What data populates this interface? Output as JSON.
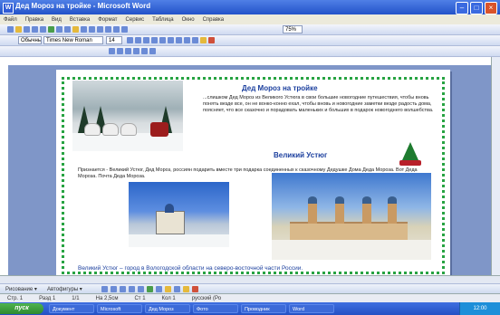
{
  "window": {
    "title": "Дед Мороз на тройке - Microsoft Word",
    "icon": "word-icon",
    "buttons": [
      "minimize-icon",
      "maximize-icon",
      "close-icon"
    ]
  },
  "menubar": {
    "items": [
      "Файл",
      "Правка",
      "Вид",
      "Вставка",
      "Формат",
      "Сервис",
      "Таблица",
      "Окно",
      "Справка"
    ]
  },
  "toolbar": {
    "style": "Обычный",
    "font": "Times New Roman",
    "size": "14",
    "zoom": "75%"
  },
  "document": {
    "heading1": "Дед Мороз на тройке",
    "para1": "...слишком Дед Мороз из Великого Устюга в свои большие новогодние путешествия, чтобы вновь понять везде все, он не вонко-конно ехал, чтобы вновь и новогодние заметки везде радость дома, поясняет, что все сказочно и порадовать маленьких и больших в подарок новогоднего волшебства.",
    "heading2": "Великий Устюг",
    "para2": "Признается - Великий Устюг, Дед Мороз, россиян подарить вместе три подарка соединенных к сказочному Дедушке Дома Деда Мороза. Вот Деда Мороза. Почта Деда Мороза.",
    "caption": "Великий Устюг – город в Вологодской области на северо-восточной части России."
  },
  "drawbar": {
    "draw_label": "Рисование ▾",
    "autoshapes_label": "Автофигуры ▾"
  },
  "statusbar": {
    "page": "Стр. 1",
    "section": "Разд 1",
    "pages": "1/1",
    "position": "На 2,5см",
    "line": "Ст 1",
    "col": "Кол 1",
    "lang": "русский (Ро"
  },
  "taskbar": {
    "start_label": "пуск",
    "tasks": [
      "Документ",
      "Microsoft",
      "Дед Мороз",
      "Фото",
      "Проводник",
      "Word"
    ],
    "clock": "12:00"
  }
}
